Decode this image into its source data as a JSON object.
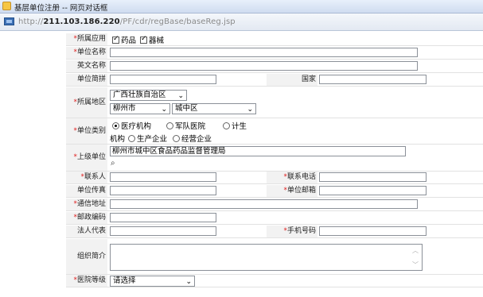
{
  "window": {
    "title": "基层单位注册 -- 网页对话框"
  },
  "address": {
    "url_prefix": "http://",
    "url_host": "211.103.186.220",
    "url_path": "/PF/cdr/regBase/baseReg.jsp"
  },
  "form": {
    "required_mark": "*",
    "fields": {
      "app": {
        "label": "所属应用",
        "opt1": "药品",
        "opt2": "器械"
      },
      "name": {
        "label": "单位名称"
      },
      "en_name": {
        "label": "英文名称"
      },
      "short": {
        "label": "单位简拼"
      },
      "country": {
        "label": "国家"
      },
      "region": {
        "label": "所属地区",
        "province": "广西壮族自治区",
        "city": "柳州市",
        "district": "城中区"
      },
      "category": {
        "label": "单位类别",
        "opt1": "医疗机构",
        "opt2": "军队医院",
        "opt3_line1": "计生",
        "opt3_line2": "机构",
        "opt4": "生产企业",
        "opt5": "经营企业"
      },
      "superior": {
        "label": "上级单位",
        "value": "柳州市城中区食品药品监督管理局"
      },
      "contact": {
        "label": "联系人"
      },
      "phone": {
        "label": "联系电话"
      },
      "fax": {
        "label": "单位传真"
      },
      "email": {
        "label": "单位邮箱"
      },
      "address": {
        "label": "通信地址"
      },
      "postcode": {
        "label": "邮政编码"
      },
      "legal": {
        "label": "法人代表"
      },
      "mobile": {
        "label": "手机号码"
      },
      "intro": {
        "label": "组织简介"
      },
      "level": {
        "label": "医院等级",
        "value": "请选择"
      }
    }
  }
}
